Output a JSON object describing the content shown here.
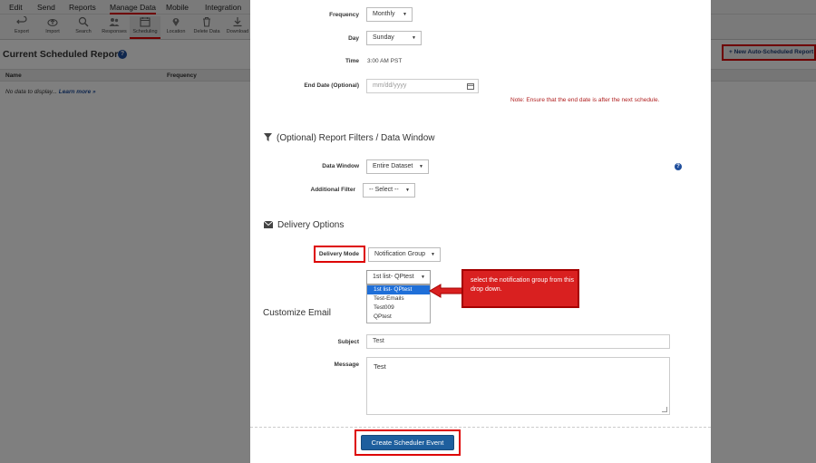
{
  "menubar": {
    "items": [
      "Edit",
      "Send",
      "Reports",
      "Manage Data",
      "Mobile",
      "Integration"
    ]
  },
  "toolbar": {
    "items": [
      {
        "label": "Export",
        "icon": "undo-arrow-icon"
      },
      {
        "label": "Import",
        "icon": "cloud-upload-icon"
      },
      {
        "label": "Search",
        "icon": "search-icon"
      },
      {
        "label": "Responses",
        "icon": "users-icon"
      },
      {
        "label": "Scheduling",
        "icon": "calendar-icon"
      },
      {
        "label": "Location",
        "icon": "map-pin-icon"
      },
      {
        "label": "Delete Data",
        "icon": "trash-icon"
      },
      {
        "label": "Download",
        "icon": "download-icon"
      }
    ]
  },
  "page": {
    "title": "Current Scheduled Reports",
    "new_button": "+ New Auto-Scheduled Report",
    "columns": [
      "Name",
      "Frequency"
    ],
    "no_data_text": "No data to display...",
    "learn_more": "Learn more »"
  },
  "form": {
    "frequency_label": "Frequency",
    "frequency_value": "Monthly",
    "day_label": "Day",
    "day_value": "Sunday",
    "time_label": "Time",
    "time_value": "3:00 AM PST",
    "end_date_label": "End Date (Optional)",
    "end_date_placeholder": "mm/dd/yyyy",
    "end_date_note": "Note: Ensure that the end date is after the next schedule."
  },
  "filters": {
    "heading": "(Optional) Report Filters / Data Window",
    "data_window_label": "Data Window",
    "data_window_value": "Entire Dataset",
    "additional_filter_label": "Additional Filter",
    "additional_filter_value": "-- Select --"
  },
  "delivery": {
    "heading": "Delivery Options",
    "mode_label": "Delivery Mode",
    "mode_value": "Notification Group",
    "group_value": "1st list- QPtest",
    "group_options": [
      "1st list- QPtest",
      "Test-Emails",
      "Test009",
      "QPtest"
    ]
  },
  "callout": {
    "text": "select the notification group from this drop down."
  },
  "email": {
    "heading": "Customize Email",
    "subject_label": "Subject",
    "subject_value": "Test",
    "message_label": "Message",
    "message_value": "Test"
  },
  "footer": {
    "create_button": "Create Scheduler Event"
  },
  "colors": {
    "accent": "#1e5f9e",
    "highlight": "#dd0000",
    "selected_option": "#1f6fd8",
    "note": "#b02020"
  }
}
